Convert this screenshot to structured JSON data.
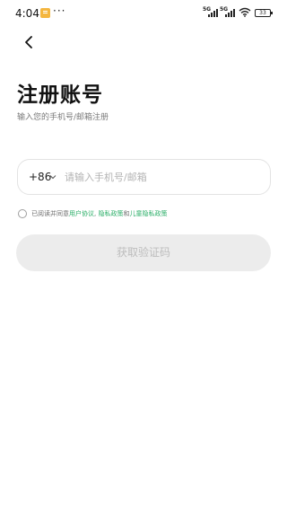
{
  "status_bar": {
    "time": "4:04",
    "more": "···",
    "signal1_label": "5G",
    "signal2_label": "5G",
    "battery": "33"
  },
  "header": {
    "title": "注册账号",
    "subtitle": "输入您的手机号/邮箱注册"
  },
  "form": {
    "country_code": "+86",
    "phone_placeholder": "请输入手机号/邮箱",
    "phone_value": "",
    "submit_label": "获取验证码"
  },
  "agreement": {
    "checked": false,
    "prefix": "已阅读并同意",
    "link_user": "用户协议",
    "sep1": ", ",
    "link_privacy": "隐私政策",
    "sep2": "和",
    "link_children": "儿童隐私政策"
  },
  "colors": {
    "link": "#2aae67",
    "button_disabled_bg": "#ececec",
    "button_disabled_text": "#bdbdbd",
    "note_icon": "#f4b63f"
  },
  "icons": [
    "note-icon",
    "more-icon",
    "signal-icon",
    "wifi-icon",
    "battery-icon",
    "back-arrow-icon",
    "chevron-down-icon",
    "checkbox-circle-icon"
  ]
}
